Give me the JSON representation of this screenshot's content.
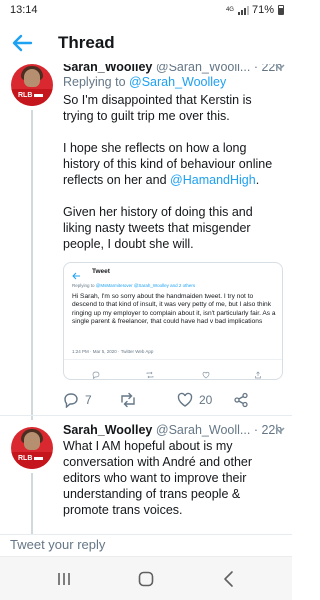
{
  "status_bar": {
    "time": "13:14",
    "network": "4G",
    "battery": "71%"
  },
  "header": {
    "title": "Thread"
  },
  "tweets": [
    {
      "name": "Sarah_Woolley",
      "handle": "@Sarah_Wooll...",
      "time": "· 22h",
      "replying_label": "Replying to",
      "replying_to": "@Sarah_Woolley",
      "paragraph1": "So I'm disappointed that Kerstin is trying to guilt trip me over this.",
      "paragraph2_pre": "I hope she reflects on how a long history of this kind of behaviour online reflects on her and",
      "paragraph2_link": "@HamandHigh",
      "paragraph2_post": ".",
      "paragraph3": "Given her history of doing this and liking nasty tweets that misgender people, I doubt she will.",
      "embed": {
        "title": "Tweet",
        "replying_label": "Replying to",
        "replying_to": "@MsMarmiteIover @Sarah_Woolley and 2 others",
        "text": "Hi Sarah, I'm so sorry about the handmaiden tweet. I try not to descend to that kind of insult, it was very petty of me, but I also think ringing up my employer to complain about it, isn't particularly fair. As a single parent & freelancer, that could have had v bad implications",
        "time": "1:24 PM · Mar 5, 2020 · Twitter Web App"
      },
      "replies": "7",
      "retweets": "",
      "likes": "20"
    },
    {
      "name": "Sarah_Woolley",
      "handle": "@Sarah_Wooll...",
      "time": "· 22h",
      "text": "What I AM hopeful about is my conversation with André and other editors who want to improve their understanding of trans people & promote trans voices."
    }
  ],
  "avatar_badge": "RLB",
  "reply_bar": {
    "placeholder": "Tweet your reply"
  },
  "colors": {
    "accent": "#1da1f2",
    "text": "#14171a",
    "secondary": "#657786",
    "avatar_red": "#c4161c"
  },
  "icons": [
    "back-arrow-icon",
    "caret-down-icon",
    "reply-icon",
    "retweet-icon",
    "like-icon",
    "share-icon",
    "recents-icon",
    "home-icon",
    "nav-back-icon"
  ]
}
